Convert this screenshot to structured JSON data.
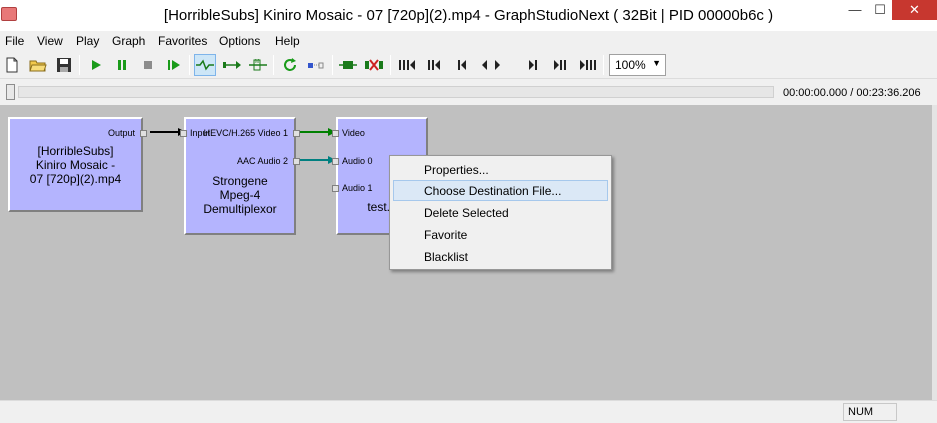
{
  "window": {
    "title": "[HorribleSubs] Kiniro Mosaic - 07 [720p](2).mp4 - GraphStudioNext ( 32Bit | PID 00000b6c )",
    "minimize_glyph": "—",
    "maximize_glyph": "☐",
    "close_glyph": "✕"
  },
  "menu": [
    "File",
    "View",
    "Play",
    "Graph",
    "Favorites",
    "Options",
    "Help"
  ],
  "toolbar": {
    "zoom": "100%",
    "icons": [
      "new-file-icon",
      "open-folder-icon",
      "save-icon",
      "play-icon",
      "pause-icon",
      "stop-icon",
      "step-frame-icon",
      "connect-mode-icon",
      "direct-connect-icon",
      "render-pins-icon",
      "refresh-icon",
      "clock-icon",
      "insert-filter-icon",
      "disconnect-icon",
      "seek-start-icon",
      "seek-back-large-icon",
      "seek-back-icon",
      "frame-step-icon",
      "seek-forward-icon",
      "seek-forward-large-icon",
      "seek-end-icon"
    ]
  },
  "seek": {
    "position": 0,
    "time": "00:00:00.000 / 00:23:36.206"
  },
  "graph": {
    "filters": [
      {
        "id": "source",
        "name_lines": [
          "[HorribleSubs]",
          "Kiniro Mosaic -",
          "07 [720p](2).mp4"
        ],
        "pins": {
          "out": [
            "Output"
          ]
        }
      },
      {
        "id": "demux",
        "name_lines": [
          "Strongene",
          "Mpeg-4",
          "Demultiplexor"
        ],
        "pins": {
          "in": [
            "Input"
          ],
          "out": [
            "HEVC/H.265 Video 1",
            "AAC Audio 2"
          ]
        }
      },
      {
        "id": "dest",
        "name_lines": [
          "test.a"
        ],
        "pins": {
          "in": [
            "Video",
            "Audio 0",
            "Audio 1"
          ]
        }
      }
    ],
    "colors": {
      "filter_fill": "#b4b4fe",
      "canvas": "#c0c0c0",
      "video_link": "#008000",
      "audio_link": "#008080",
      "source_link": "#000000"
    }
  },
  "context_menu": {
    "items": [
      "Properties...",
      "Choose Destination File...",
      "Delete Selected",
      "Favorite",
      "Blacklist"
    ],
    "highlighted": "Choose Destination File..."
  },
  "status": {
    "num": "NUM"
  }
}
